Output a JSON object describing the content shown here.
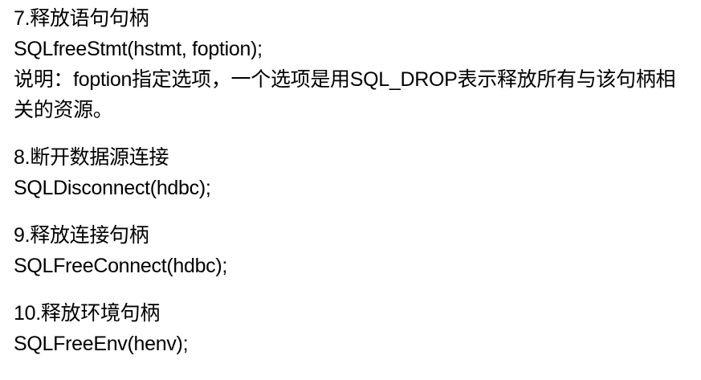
{
  "sections": [
    {
      "heading": "7.释放语句句柄",
      "code": "SQLfreeStmt(hstmt, foption);",
      "note": "说明：foption指定选项，一个选项是用SQL_DROP表示释放所有与该句柄相关的资源。"
    },
    {
      "heading": "8.断开数据源连接",
      "code": "SQLDisconnect(hdbc);"
    },
    {
      "heading": "9.释放连接句柄",
      "code": "SQLFreeConnect(hdbc);"
    },
    {
      "heading": "10.释放环境句柄",
      "code": "SQLFreeEnv(henv);"
    }
  ]
}
